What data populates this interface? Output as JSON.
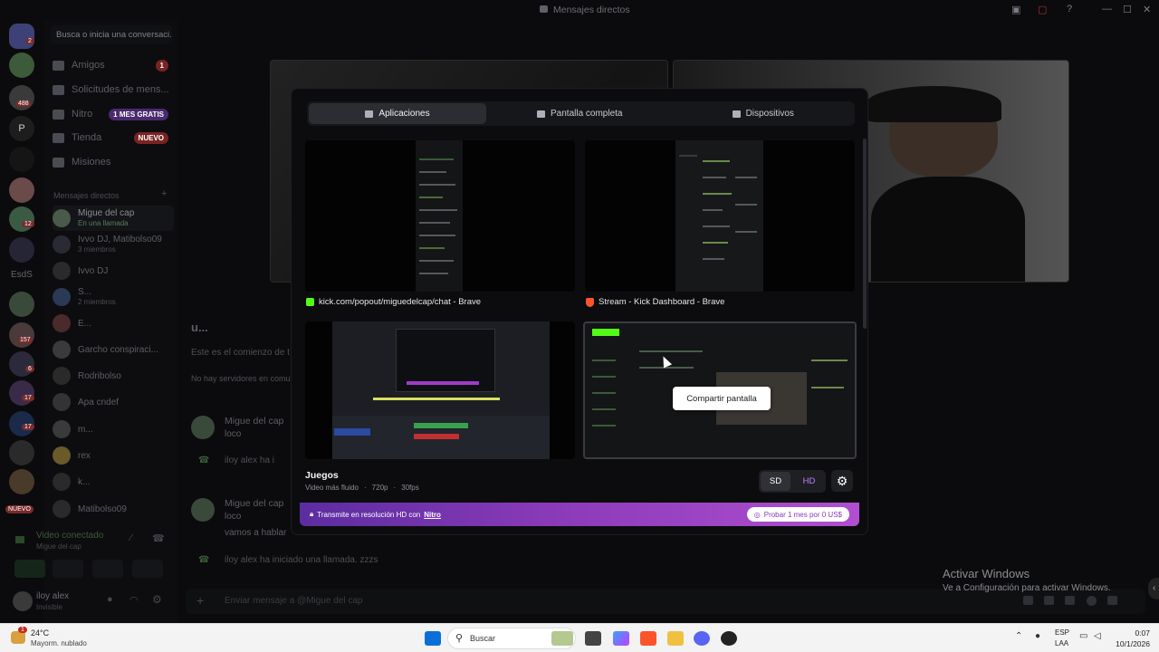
{
  "window": {
    "title": "Mensajes directos"
  },
  "sidebar": {
    "search_placeholder": "Busca o inicia una conversaci...",
    "server_badges": {
      "home": "2",
      "s2": "488",
      "s10": "12",
      "s14": "157",
      "s15": "6",
      "s16": "17",
      "s17": "17"
    },
    "server_labels": {
      "p": "P",
      "esds": "EsdS",
      "nuevo": "NUEVO"
    },
    "nav": [
      {
        "label": "Amigos",
        "badge": "1"
      },
      {
        "label": "Solicitudes de mens...",
        "badge": ""
      },
      {
        "label": "Nitro",
        "badge": "1 MES GRATIS"
      },
      {
        "label": "Tienda",
        "badge": "NUEVO"
      },
      {
        "label": "Misiones",
        "badge": ""
      }
    ],
    "dm_header": "Mensajes directos",
    "dms": [
      {
        "name": "Migue del cap",
        "sub": "En una llamada"
      },
      {
        "name": "Ivvo DJ, Matibolso09",
        "sub": "3 miembros"
      },
      {
        "name": "Ivvo DJ",
        "sub": ""
      },
      {
        "name": "S...",
        "sub": "2 miembros"
      },
      {
        "name": "E...",
        "sub": ""
      },
      {
        "name": "Garcho conspiraci...",
        "sub": ""
      },
      {
        "name": "Rodribolso",
        "sub": ""
      },
      {
        "name": "Apa cndef",
        "sub": ""
      },
      {
        "name": "m...",
        "sub": ""
      },
      {
        "name": "rex",
        "sub": ""
      },
      {
        "name": "k...",
        "sub": ""
      },
      {
        "name": "Matibolso09",
        "sub": ""
      }
    ],
    "voice": {
      "status": "Video conectado",
      "channel": "Migue del cap"
    },
    "user": {
      "name": "iloy alex",
      "status": "Invisible"
    }
  },
  "chat": {
    "title": "u...",
    "intro": "Este es el comienzo de t",
    "servers": "No hay servidores en comun",
    "messages": [
      {
        "name": "Migue del cap",
        "lines": [
          "loco"
        ]
      },
      {
        "name": "",
        "lines": [
          "iloy alex ha i"
        ]
      },
      {
        "name": "Migue del cap",
        "lines": [
          "loco",
          "vamos a hablar"
        ]
      },
      {
        "name": "",
        "lines": [
          "iloy alex ha iniciado una llamada. zzzs"
        ]
      }
    ],
    "input_placeholder": "Enviar mensaje a @Migue del cap"
  },
  "modal": {
    "tabs": [
      "Aplicaciones",
      "Pantalla completa",
      "Dispositivos"
    ],
    "cards": [
      {
        "caption": "kick.com/popout/miguedelcap/chat - Brave",
        "icon": "kick-icon"
      },
      {
        "caption": "Stream - Kick Dashboard - Brave",
        "icon": "brave-icon"
      },
      {
        "caption": "",
        "icon": ""
      },
      {
        "caption": "",
        "icon": "",
        "hover_button": "Compartir pantalla"
      }
    ],
    "section": "Juegos",
    "meta": [
      "Video más fluido",
      "720p",
      "30fps"
    ],
    "quality": [
      "SD",
      "HD"
    ],
    "nitro": {
      "text": "Transmite en resolución HD con",
      "link": "Nitro",
      "cta": "Probar 1 mes por 0 US$"
    }
  },
  "watermark": {
    "title": "Activar Windows",
    "subtitle": "Ve a Configuración para activar Windows."
  },
  "taskbar": {
    "weather_temp": "24°C",
    "weather_desc": "Mayorm. nublado",
    "weather_badge": "1",
    "search": "Buscar",
    "lang1": "ESP",
    "lang2": "LAA",
    "time": "0:07",
    "date": "10/1/2026"
  }
}
